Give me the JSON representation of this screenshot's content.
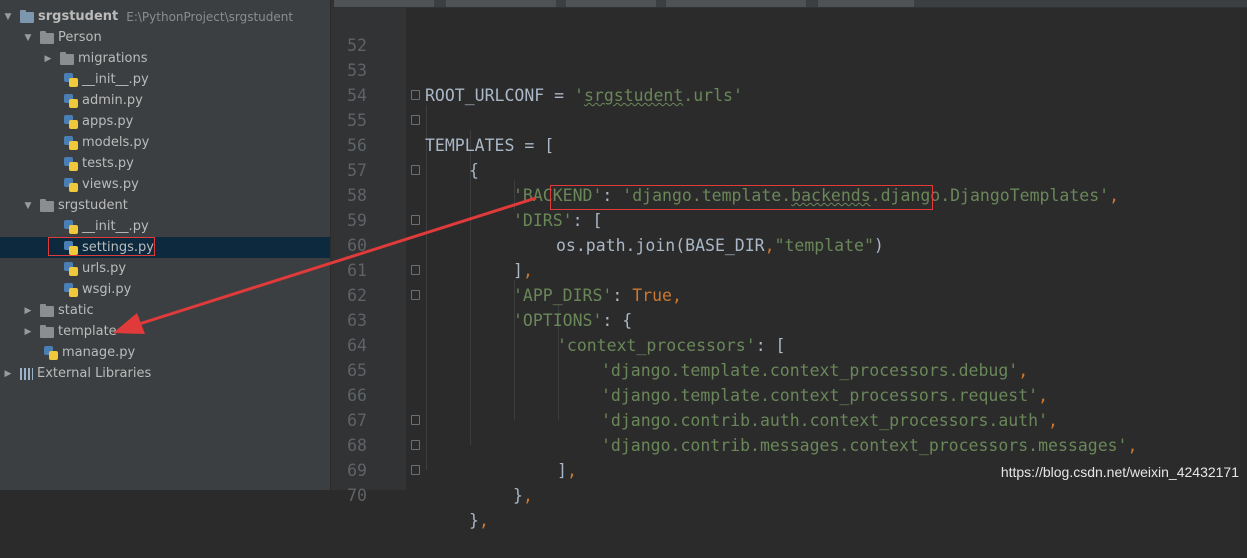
{
  "project_tree": {
    "root": {
      "name": "srgstudent",
      "path": "E:\\PythonProject\\srgstudent"
    },
    "items": [
      {
        "label": "Person",
        "icon": "folder-icon"
      },
      {
        "label": "migrations",
        "icon": "folder-icon"
      },
      {
        "label": "__init__.py",
        "icon": "python-file-icon"
      },
      {
        "label": "admin.py",
        "icon": "python-file-icon"
      },
      {
        "label": "apps.py",
        "icon": "python-file-icon"
      },
      {
        "label": "models.py",
        "icon": "python-file-icon"
      },
      {
        "label": "tests.py",
        "icon": "python-file-icon"
      },
      {
        "label": "views.py",
        "icon": "python-file-icon"
      },
      {
        "label": "srgstudent",
        "icon": "folder-icon"
      },
      {
        "label": "__init__.py",
        "icon": "python-file-icon"
      },
      {
        "label": "settings.py",
        "icon": "python-file-icon"
      },
      {
        "label": "urls.py",
        "icon": "python-file-icon"
      },
      {
        "label": "wsgi.py",
        "icon": "python-file-icon"
      },
      {
        "label": "static",
        "icon": "folder-icon"
      },
      {
        "label": "template",
        "icon": "folder-icon"
      },
      {
        "label": "manage.py",
        "icon": "python-file-icon"
      },
      {
        "label": "External Libraries",
        "icon": "library-icon"
      }
    ]
  },
  "editor": {
    "lines": [
      {
        "num": "52"
      },
      {
        "num": "53",
        "a": "ROOT_URLCONF = ",
        "b": "'",
        "c": "srgstudent",
        "d": ".urls'"
      },
      {
        "num": "54"
      },
      {
        "num": "55",
        "a": "TEMPLATES = ["
      },
      {
        "num": "56",
        "a": "{"
      },
      {
        "num": "57",
        "a": "'BACKEND'",
        "b": ": ",
        "c": "'django.template.",
        "d": "backends",
        "e": ".django.DjangoTemplates'",
        "f": ","
      },
      {
        "num": "58",
        "a": "'DIRS'",
        "b": ": ["
      },
      {
        "num": "59",
        "a": "os.path.join(BASE_DIR",
        "b": ",",
        "c": "\"template\"",
        "d": ")"
      },
      {
        "num": "60",
        "a": "]",
        "b": ","
      },
      {
        "num": "61",
        "a": "'APP_DIRS'",
        "b": ": ",
        "c": "True",
        "d": ","
      },
      {
        "num": "62",
        "a": "'OPTIONS'",
        "b": ": {"
      },
      {
        "num": "63",
        "a": "'context_processors'",
        "b": ": ["
      },
      {
        "num": "64",
        "a": "'django.template.context_processors.debug'",
        "b": ","
      },
      {
        "num": "65",
        "a": "'django.template.context_processors.request'",
        "b": ","
      },
      {
        "num": "66",
        "a": "'django.contrib.auth.context_processors.auth'",
        "b": ","
      },
      {
        "num": "67",
        "a": "'django.contrib.messages.context_processors.messages'",
        "b": ","
      },
      {
        "num": "68",
        "a": "]",
        "b": ","
      },
      {
        "num": "69",
        "a": "}",
        "b": ","
      },
      {
        "num": "70",
        "a": "}",
        "b": ","
      }
    ]
  },
  "watermark": "https://blog.csdn.net/weixin_42432171",
  "colors": {
    "annotation_red": "#e03a3a",
    "string_green": "#6a8759",
    "keyword_orange": "#cc7832",
    "selection_blue": "#0d293e"
  }
}
